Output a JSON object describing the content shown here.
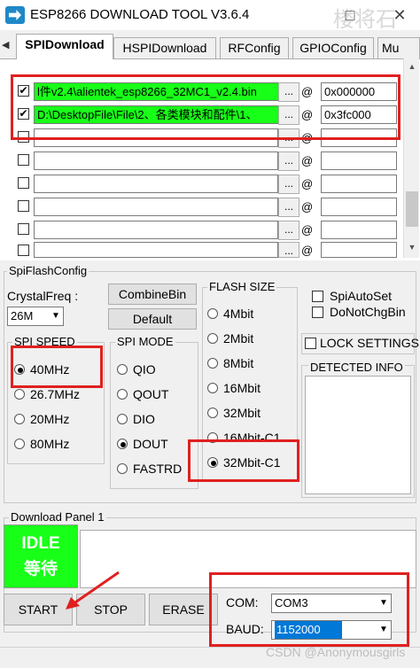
{
  "window": {
    "title": "ESP8266 DOWNLOAD TOOL V3.6.4",
    "watermark": "楼将石",
    "min_label": "□",
    "close_label": "✕"
  },
  "tabs": [
    {
      "label": "SPIDownload",
      "active": true
    },
    {
      "label": "HSPIDownload",
      "active": false
    },
    {
      "label": "RFConfig",
      "active": false
    },
    {
      "label": "GPIOConfig",
      "active": false
    },
    {
      "label": "Mu",
      "active": false
    }
  ],
  "files": [
    {
      "checked": true,
      "path": "l件v2.4\\alientek_esp8266_32MC1_v2.4.bin",
      "address": "0x000000",
      "highlight": true
    },
    {
      "checked": true,
      "path": "D:\\DesktopFile\\File\\2、各类模块和配件\\1、",
      "address": "0x3fc000",
      "highlight": true
    },
    {
      "checked": false,
      "path": "",
      "address": "",
      "highlight": false
    },
    {
      "checked": false,
      "path": "",
      "address": "",
      "highlight": false
    },
    {
      "checked": false,
      "path": "",
      "address": "",
      "highlight": false
    },
    {
      "checked": false,
      "path": "",
      "address": "",
      "highlight": false
    },
    {
      "checked": false,
      "path": "",
      "address": "",
      "highlight": false
    },
    {
      "checked": false,
      "path": "",
      "address": "",
      "highlight": false
    }
  ],
  "browse_label": "...",
  "at_label": "@",
  "spiflash": {
    "group_label": "SpiFlashConfig",
    "crystal_label": "CrystalFreq :",
    "crystal_value": "26M",
    "combine_label": "CombineBin",
    "default_label": "Default",
    "spi_speed_label": "SPI SPEED",
    "spi_speed_options": [
      {
        "label": "40MHz",
        "selected": true
      },
      {
        "label": "26.7MHz",
        "selected": false
      },
      {
        "label": "20MHz",
        "selected": false
      },
      {
        "label": "80MHz",
        "selected": false
      }
    ],
    "spi_mode_label": "SPI MODE",
    "spi_mode_options": [
      {
        "label": "QIO",
        "selected": false
      },
      {
        "label": "QOUT",
        "selected": false
      },
      {
        "label": "DIO",
        "selected": false
      },
      {
        "label": "DOUT",
        "selected": true
      },
      {
        "label": "FASTRD",
        "selected": false
      }
    ],
    "flash_size_label": "FLASH SIZE",
    "flash_size_options": [
      {
        "label": "4Mbit",
        "selected": false
      },
      {
        "label": "2Mbit",
        "selected": false
      },
      {
        "label": "8Mbit",
        "selected": false
      },
      {
        "label": "16Mbit",
        "selected": false
      },
      {
        "label": "32Mbit",
        "selected": false
      },
      {
        "label": "16Mbit-C1",
        "selected": false
      },
      {
        "label": "32Mbit-C1",
        "selected": true
      }
    ],
    "spi_auto_set": "SpiAutoSet",
    "do_not_chg_bin": "DoNotChgBin",
    "lock_settings": "LOCK SETTINGS",
    "detected_info": "DETECTED INFO"
  },
  "download": {
    "panel_label": "Download Panel 1",
    "status_line1": "IDLE",
    "status_line2": "等待",
    "start_label": "START",
    "stop_label": "STOP",
    "erase_label": "ERASE",
    "com_label": "COM:",
    "com_value": "COM3",
    "baud_label": "BAUD:",
    "baud_value": "1152000"
  },
  "footer_watermark": "CSDN @Anonymousgirls",
  "colors": {
    "highlight_green": "#18ff18",
    "idle_green": "#18ff18",
    "annotation_red": "#e02020",
    "selection_blue": "#0078d7"
  }
}
